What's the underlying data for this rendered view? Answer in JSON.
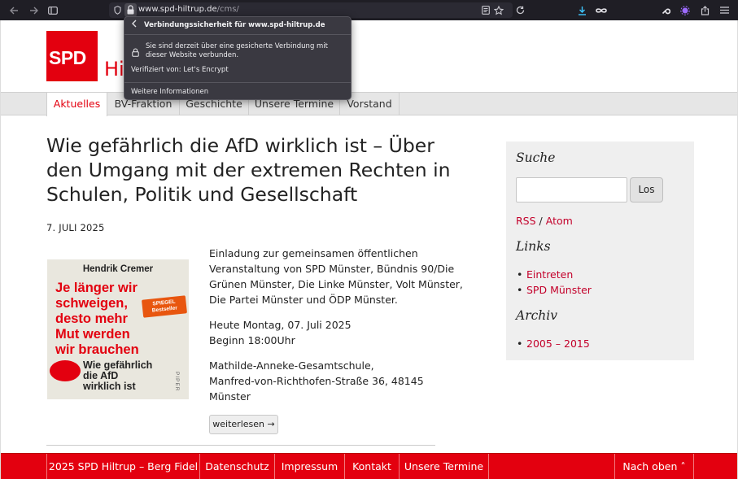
{
  "browser": {
    "url_host": "www.spd-hiltrup.de",
    "url_path": "/cms/",
    "icons": [
      "back-icon",
      "forward-icon",
      "sidebar-icon",
      "shield-icon",
      "lock-icon",
      "reader-icon",
      "bookmark-star-icon",
      "reload-icon",
      "download-icon",
      "infinity-icon",
      "wrench-icon",
      "extension-icon",
      "share-icon",
      "menu-icon"
    ]
  },
  "popup": {
    "title": "Verbindungssicherheit für www.spd-hiltrup.de",
    "message": "Sie sind derzeit über eine gesicherte Verbindung mit dieser Website verbunden.",
    "verified": "Verifiziert von: Let's Encrypt",
    "more_info": "Weitere Informationen"
  },
  "site": {
    "logo_text": "SPD",
    "title_fragment": "Hi"
  },
  "nav": [
    {
      "label": "Aktuelles",
      "active": true
    },
    {
      "label": "BV-Fraktion",
      "active": false
    },
    {
      "label": "Geschichte",
      "active": false
    },
    {
      "label": "Unsere Termine",
      "active": false
    },
    {
      "label": "Vorstand",
      "active": false
    }
  ],
  "article": {
    "title_lines": [
      "Wie gefährlich die AfD wirklich ist – Über",
      "den Umgang mit der extremen Rechten in",
      "Schulen, Politik und Gesellschaft"
    ],
    "date": "7. JULI 2025",
    "paragraph1": [
      "Einladung zur gemeinsamen öffentlichen",
      "Veranstaltung von SPD Münster, Bündnis 90/Die",
      "Grünen Münster, Die Linke Münster, Volt Münster,",
      "Die Partei Münster und ÖDP Münster."
    ],
    "paragraph2": [
      "Heute Montag, 07. Juli 2025",
      "Beginn 18:00Uhr"
    ],
    "paragraph3": [
      "Mathilde-Anneke-Gesamtschule,",
      "Manfred-von-Richthofen-Straße 36, 48145",
      "Münster"
    ],
    "more_button": "weiterlesen →",
    "book": {
      "author": "Hendrik Cremer",
      "title_red_lines": [
        "Je länger wir",
        "schweigen,",
        "desto mehr",
        "Mut werden",
        "wir brauchen"
      ],
      "subtitle_lines": [
        "Wie gefährlich",
        "die AfD",
        "wirklich ist"
      ],
      "badge": "SPIEGEL Bestseller",
      "publisher": "PIPER"
    }
  },
  "sidebar": {
    "search_heading": "Suche",
    "search_button": "Los",
    "search_placeholder": "",
    "feed_rss": "RSS",
    "feed_separator": " / ",
    "feed_atom": "Atom",
    "links_heading": "Links",
    "links": [
      "Eintreten",
      "SPD Münster"
    ],
    "archive_heading": "Archiv",
    "archive": [
      "2005 – 2015"
    ]
  },
  "footer": {
    "items": [
      "2025 SPD Hiltrup – Berg Fidel",
      "Datenschutz",
      "Impressum",
      "Kontakt",
      "Unsere Termine"
    ],
    "back_to_top": "Nach oben ˄"
  },
  "colors": {
    "spd_red": "#e3000f",
    "link_red": "#c3002a",
    "toolbar": "#1f1e25",
    "popup": "#3a3941"
  }
}
